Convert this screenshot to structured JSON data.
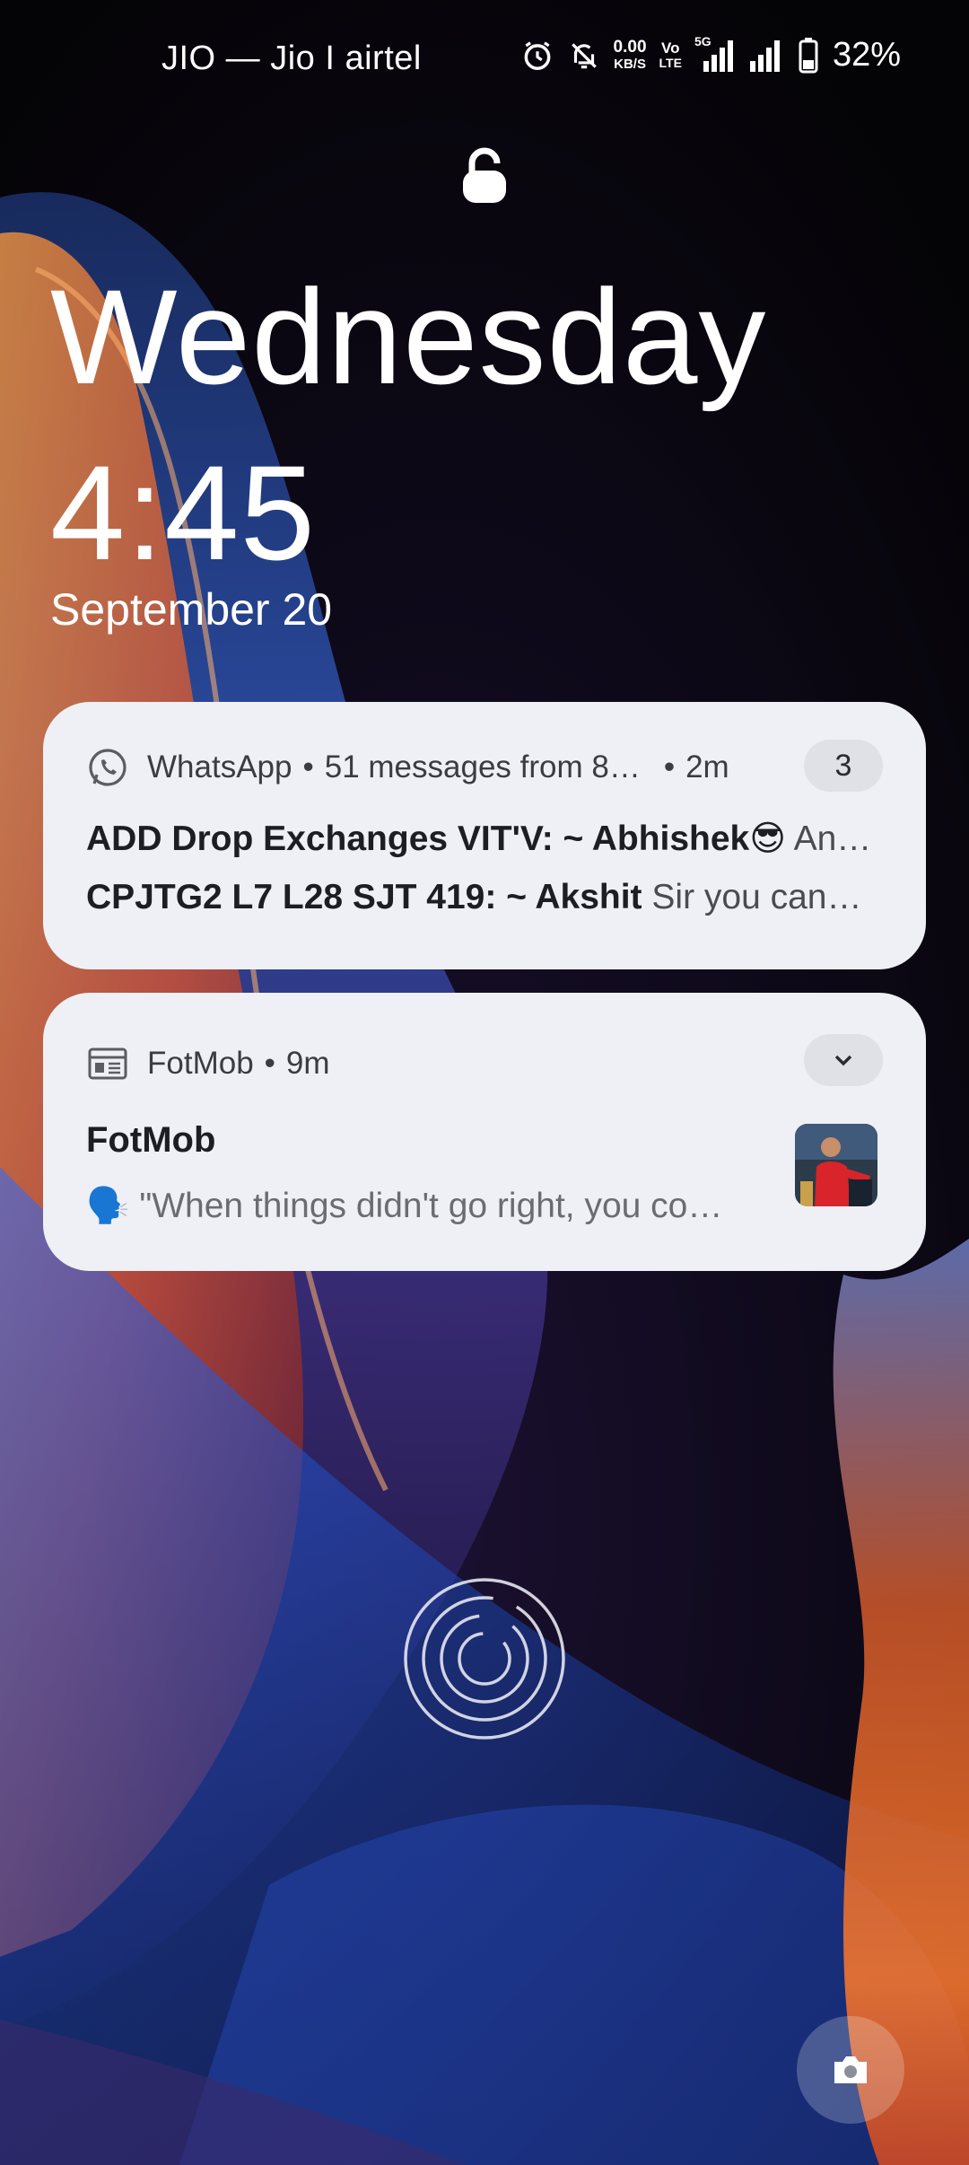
{
  "status_bar": {
    "carrier": "JIO — Jio I airtel",
    "net_speed_value": "0.00",
    "net_speed_unit": "KB/S",
    "volte_top": "Vo",
    "volte_bottom": "LTE",
    "network_badge": "5G",
    "battery_percent": "32%",
    "icons": [
      "alarm-icon",
      "bell-off-icon",
      "signal-icon",
      "battery-icon"
    ]
  },
  "lockscreen": {
    "day": "Wednesday",
    "time": "4:45",
    "date": "September 20"
  },
  "notifications": [
    {
      "app": "WhatsApp",
      "summary": "51 messages from 8…",
      "age": "2m",
      "count": "3",
      "messages": [
        {
          "sender": "ADD Drop Exchanges VIT'V: ~ Abhishek😎",
          "text": "An…"
        },
        {
          "sender": "CPJTG2 L7 L28 SJT 419: ~ Akshit",
          "text": "Sir you can…"
        }
      ]
    },
    {
      "app": "FotMob",
      "age": "9m",
      "title": "FotMob",
      "text": "🗣️ \"When things didn't go right, you co…"
    }
  ],
  "colors": {
    "card_bg": "#eef0f5",
    "badge_bg": "#dfe1e7",
    "text_dark": "#1d1d22"
  }
}
